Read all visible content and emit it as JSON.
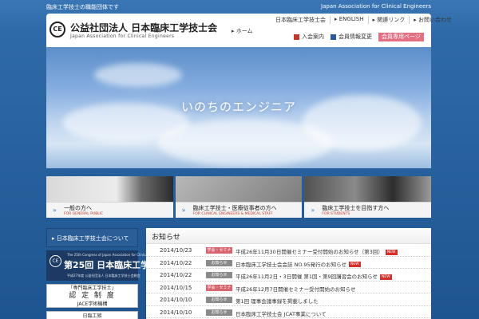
{
  "topbar": {
    "tagline": "臨床工学技士の職能団体です",
    "assoc_en": "Japan Association for Clinical Engineers"
  },
  "header": {
    "logo_mark": "CE",
    "title": "公益社団法人 日本臨床工学技士会",
    "subtitle": "Japan Association for Clinical Engineers",
    "home": "▸ ホーム",
    "util_links": [
      "日本臨床工学技士会",
      "▸ ENGLISH",
      "▸ 関連リンク",
      "▸ お問い合わせ"
    ],
    "member_links": {
      "join": "入会案内",
      "change": "会員情報変更",
      "members": "会員専用ページ"
    }
  },
  "hero": {
    "caption": "いのちのエンジニア"
  },
  "cards": [
    {
      "title": "一般の方へ",
      "sub": "FOR GENERAL PUBLIC"
    },
    {
      "title": "臨床工学技士・医療従事者の方へ",
      "sub": "FOR CLINICAL ENGINEERS & MEDICAL STAFF"
    },
    {
      "title": "臨床工学技士を目指す方へ",
      "sub": "FOR STUDENTS"
    }
  ],
  "sidebar": {
    "about_btn": "▸ 日本臨床工学技士会について",
    "congress": {
      "line1": "The 25th Congress of Japan Association for Clinical Engineers",
      "line2": "第25回 日本臨床工学会",
      "line3": "平成27年度 公益社団法人 日本臨床工学技士会総会"
    },
    "cert": {
      "line1": "「専門臨床工学技士」",
      "line2": "認 定 制 度",
      "line3": "JACE学術機構"
    },
    "more": "日臨工雑"
  },
  "news": {
    "heading": "お知らせ",
    "items": [
      {
        "date": "2014/10/23",
        "tag": "学会・セミナー",
        "tag_type": "seminar",
        "text": "平成26年11月30日開催セミナー受付開始のお知らせ（第3回）",
        "new": true
      },
      {
        "date": "2014/10/22",
        "tag": "お知らせ",
        "tag_type": "notice",
        "text": "日本臨床工学技士会会誌 NO.95発行のお知らせ",
        "new": true
      },
      {
        "date": "2014/10/22",
        "tag": "お知らせ",
        "tag_type": "notice",
        "text": "平成26年11月2日・3日開催 第1回・第9回講習会のお知らせ",
        "new": true
      },
      {
        "date": "2014/10/15",
        "tag": "学会・セミナー",
        "tag_type": "seminar",
        "text": "平成26年12月7日開催セミナー受付開始のお知らせ",
        "new": false
      },
      {
        "date": "2014/10/10",
        "tag": "お知らせ",
        "tag_type": "notice",
        "text": "第1回 理事会議事録を掲載しました",
        "new": false
      },
      {
        "date": "2014/10/10",
        "tag": "お知らせ",
        "tag_type": "notice",
        "text": "日本臨床工学技士会 JCAT事業について",
        "new": false
      },
      {
        "date": "2014/10/09",
        "tag": "行政情報",
        "tag_type": "jimu",
        "text": "厚生労働省からのお知らせ",
        "new": false
      }
    ]
  }
}
